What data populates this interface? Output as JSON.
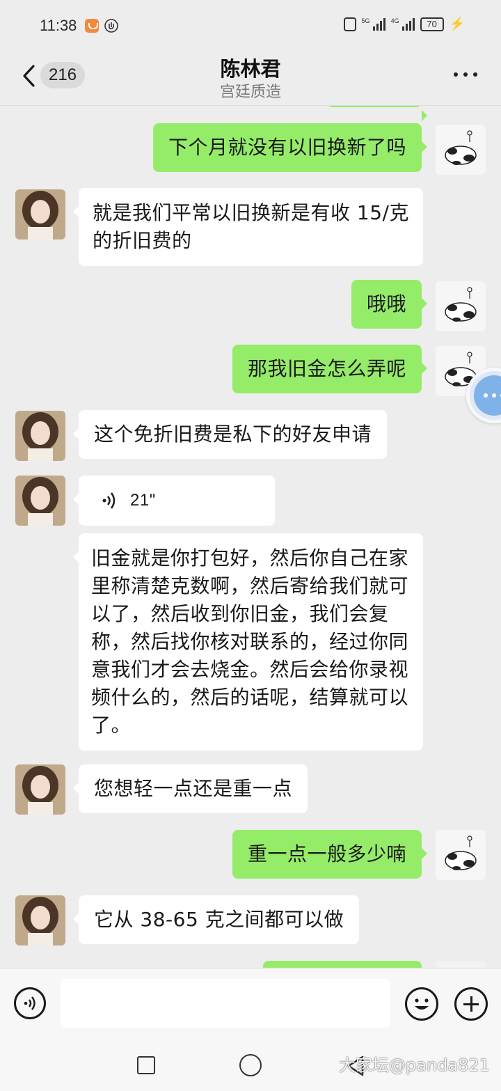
{
  "status_bar": {
    "time": "11:38",
    "network_1": "5G",
    "network_2": "4G",
    "battery": "70"
  },
  "header": {
    "unread_count": "216",
    "title": "陈林君",
    "subtitle": "宫廷质造"
  },
  "messages": [
    {
      "side": "right",
      "type": "text",
      "text": "下个月就没有以旧换新了吗"
    },
    {
      "side": "left",
      "type": "text",
      "text": "就是我们平常以旧换新是有收 15/克的折旧费的"
    },
    {
      "side": "right",
      "type": "text",
      "text": "哦哦"
    },
    {
      "side": "right",
      "type": "text",
      "text": "那我旧金怎么弄呢"
    },
    {
      "side": "left",
      "type": "text",
      "text": "这个免折旧费是私下的好友申请"
    },
    {
      "side": "left",
      "type": "voice",
      "duration": "21\""
    },
    {
      "side": "left",
      "type": "text",
      "text": "旧金就是你打包好，然后你自己在家里称清楚克数啊，然后寄给我们就可以了，然后收到你旧金，我们会复称，然后找你核对联系的，经过你同意我们才会去烧金。然后会给你录视频什么的，然后的话呢，结算就可以了。"
    },
    {
      "side": "left",
      "type": "text",
      "text": "您想轻一点还是重一点"
    },
    {
      "side": "right",
      "type": "text",
      "text": "重一点一般多少喃"
    },
    {
      "side": "left",
      "type": "text",
      "text": "它从 38-65 克之间都可以做"
    }
  ],
  "input": {
    "placeholder": ""
  },
  "watermark": "大家坛@panda821",
  "colors": {
    "background": "#ededed",
    "sent_bubble": "#95ec69",
    "received_bubble": "#ffffff"
  }
}
